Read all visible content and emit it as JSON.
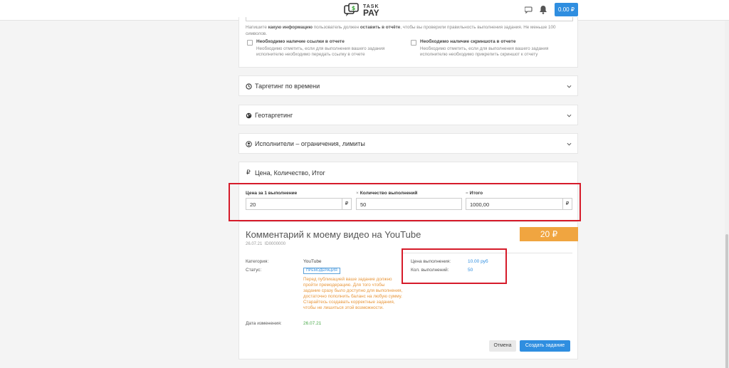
{
  "header": {
    "logo_line1": "TASK",
    "logo_line2": "PAY",
    "balance": "0.00 ₽"
  },
  "report_requirements": {
    "hint_prefix": "Напишите",
    "hint_bold1": "какую информацию",
    "hint_mid": "пользователь должен",
    "hint_bold2": "оставить в отчёте",
    "hint_suffix": ", чтобы вы проверили правильность выполнения задания. Не меньше 100 символов.",
    "checkboxes": [
      {
        "title": "Необходимо наличие ссылки в отчете",
        "description": "Необходимо отметить, если для выполнения вашего задания исполнителю необходимо передать ссылку в отчете",
        "checked": false
      },
      {
        "title": "Необходимо наличие скриншота в отчете",
        "description": "Необходимо отметить, если для выполнения вашего задания исполнителю необходимо прикрепить скриншот к отчету",
        "checked": false
      }
    ]
  },
  "sections": [
    {
      "title": "Таргетинг по времени",
      "icon": "clock-icon"
    },
    {
      "title": "Геотаргетинг",
      "icon": "globe-icon"
    },
    {
      "title": "Исполнители – ограничения, лимиты",
      "icon": "user-circle-icon"
    }
  ],
  "pricing": {
    "title": "Цена, Количество, Итог",
    "currency_symbol": "₽",
    "price_label": "Цена за 1 выполнение",
    "price_value": "20",
    "qty_operator": "×",
    "qty_label": "Количество выполнений",
    "qty_value": "50",
    "total_operator": "=",
    "total_label": "Итого",
    "total_value": "1000,00"
  },
  "task": {
    "title": "Комментарий к моему видео на YouTube",
    "date": "26.07.21",
    "id": "ID0000000",
    "price_badge": "20 ₽",
    "category_label": "Категория:",
    "category_value": "YouTube",
    "status_label": "Статус:",
    "status_value": "ПРЕМОДЕРАЦИЯ",
    "status_note": "Перед публикацией ваше задание должно пройти премодерацию. Для того чтобы задание сразу было доступно для выполнения, достаточно пополнить баланс на любую сумму. Старайтесь создавать корректные задания, чтобы не лишиться этой возможности.",
    "modified_label": "Дата изменения:",
    "modified_value": "26.07.21",
    "exec_price_label": "Цена выполнения:",
    "exec_price_value": "10.00 руб",
    "exec_count_label": "Кол. выполнений:",
    "exec_count_value": "50"
  },
  "actions": {
    "cancel": "Отмена",
    "create": "Создать задание"
  },
  "colors": {
    "accent": "#2f8ee0",
    "highlight": "#d61b2a",
    "badge": "#f0a540",
    "warning_text": "#e8963a",
    "date_green": "#4aaa4a"
  }
}
